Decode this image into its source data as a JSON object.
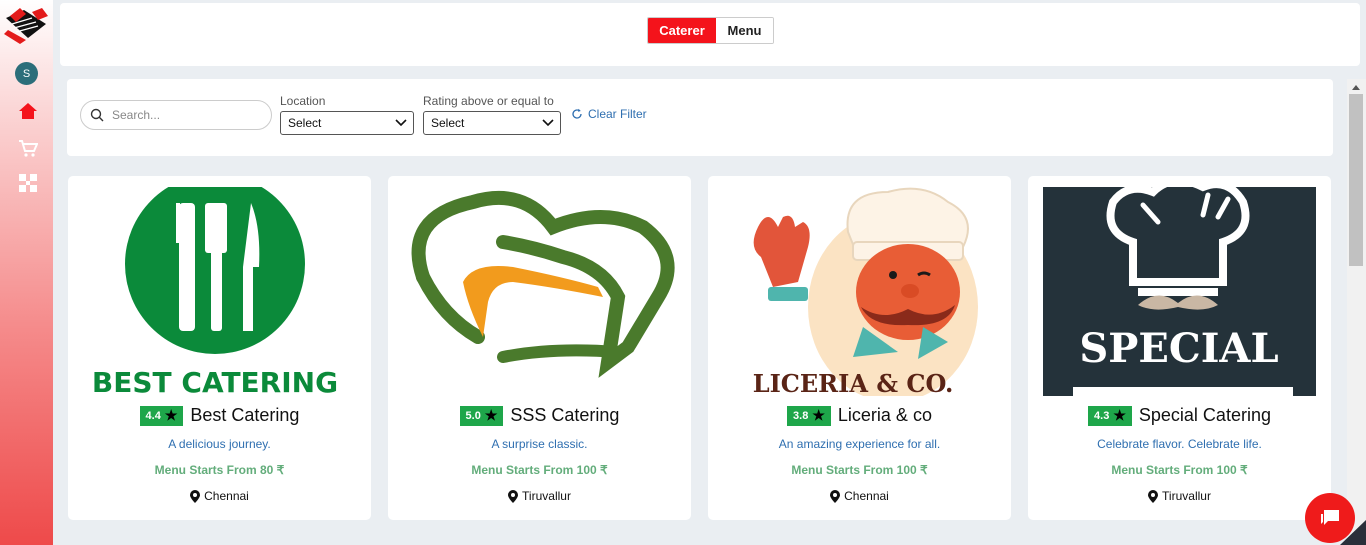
{
  "sidebar": {
    "avatar_letter": "S",
    "icons": [
      "logo-icon",
      "home-icon",
      "cart-icon",
      "grid-icon"
    ]
  },
  "topbar": {
    "tabs": [
      {
        "label": "Caterer",
        "active": true
      },
      {
        "label": "Menu",
        "active": false
      }
    ]
  },
  "filters": {
    "search_placeholder": "Search...",
    "location_label": "Location",
    "location_value": "Select",
    "rating_label": "Rating above or equal to",
    "rating_value": "Select",
    "clear_label": "Clear Filter"
  },
  "caterers": [
    {
      "rating": "4.4",
      "name": "Best Catering",
      "tagline": "A delicious journey.",
      "price": "Menu Starts From 80 ₹",
      "location": "Chennai",
      "logo_text": "BEST CATERING"
    },
    {
      "rating": "5.0",
      "name": "SSS Catering",
      "tagline": "A surprise classic.",
      "price": "Menu Starts From 100 ₹",
      "location": "Tiruvallur",
      "logo_text": ""
    },
    {
      "rating": "3.8",
      "name": "Liceria & co",
      "tagline": "An amazing experience for all.",
      "price": "Menu Starts From 100 ₹",
      "location": "Chennai",
      "logo_text": "LICERIA & CO."
    },
    {
      "rating": "4.3",
      "name": "Special Catering",
      "tagline": "Celebrate flavor. Celebrate life.",
      "price": "Menu Starts From 100 ₹",
      "location": "Tiruvallur",
      "logo_text": "SPECIAL"
    }
  ],
  "colors": {
    "accent": "#f4131b",
    "rating_bg": "#1ea64a",
    "price": "#63ad7b",
    "link": "#2f6fb0"
  }
}
